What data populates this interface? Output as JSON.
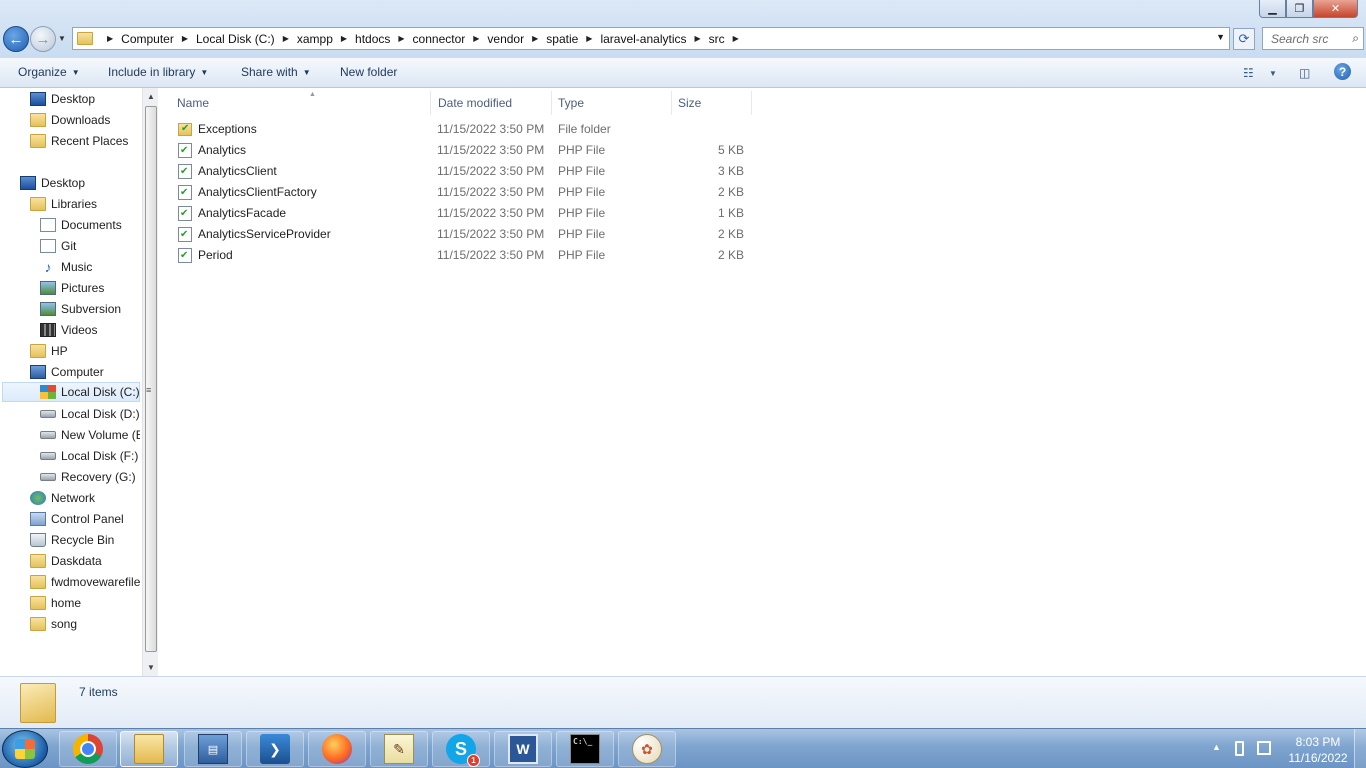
{
  "window": {
    "minimize": "▁",
    "maximize": "❐",
    "close": "✕"
  },
  "nav": {
    "back": "←",
    "forward": "→",
    "breadcrumbs": [
      "Computer",
      "Local Disk (C:)",
      "xampp",
      "htdocs",
      "connector",
      "vendor",
      "spatie",
      "laravel-analytics",
      "src"
    ],
    "search_placeholder": "Search src"
  },
  "toolbar": {
    "organize": "Organize",
    "include_in_library": "Include in library",
    "share_with": "Share with",
    "new_folder": "New folder",
    "help": "?"
  },
  "sidebar": {
    "items": [
      {
        "label": "Desktop",
        "icon": "desktop-icon"
      },
      {
        "label": "Downloads",
        "icon": "downloads-icon"
      },
      {
        "label": "Recent Places",
        "icon": "recent-places-icon"
      },
      {
        "label": "Desktop",
        "icon": "desktop-icon"
      },
      {
        "label": "Libraries",
        "icon": "libraries-icon"
      },
      {
        "label": "Documents",
        "icon": "documents-icon"
      },
      {
        "label": "Git",
        "icon": "git-icon"
      },
      {
        "label": "Music",
        "icon": "music-icon"
      },
      {
        "label": "Pictures",
        "icon": "pictures-icon"
      },
      {
        "label": "Subversion",
        "icon": "subversion-icon"
      },
      {
        "label": "Videos",
        "icon": "videos-icon"
      },
      {
        "label": "HP",
        "icon": "user-folder-icon"
      },
      {
        "label": "Computer",
        "icon": "computer-icon"
      },
      {
        "label": "Local Disk (C:)",
        "icon": "windows-drive-icon",
        "selected": true
      },
      {
        "label": "Local Disk (D:)",
        "icon": "drive-icon"
      },
      {
        "label": "New Volume (E",
        "icon": "drive-icon"
      },
      {
        "label": "Local Disk (F:)",
        "icon": "drive-icon"
      },
      {
        "label": "Recovery (G:)",
        "icon": "drive-icon"
      },
      {
        "label": "Network",
        "icon": "network-icon"
      },
      {
        "label": "Control Panel",
        "icon": "control-panel-icon"
      },
      {
        "label": "Recycle Bin",
        "icon": "recycle-bin-icon"
      },
      {
        "label": "Daskdata",
        "icon": "folder-icon"
      },
      {
        "label": "fwdmovewarefile",
        "icon": "folder-icon"
      },
      {
        "label": "home",
        "icon": "folder-icon"
      },
      {
        "label": "song",
        "icon": "folder-icon"
      }
    ]
  },
  "columns": {
    "name": "Name",
    "date": "Date modified",
    "type": "Type",
    "size": "Size"
  },
  "files": [
    {
      "name": "Exceptions",
      "date": "11/15/2022 3:50 PM",
      "type": "File folder",
      "size": ""
    },
    {
      "name": "Analytics",
      "date": "11/15/2022 3:50 PM",
      "type": "PHP File",
      "size": "5 KB"
    },
    {
      "name": "AnalyticsClient",
      "date": "11/15/2022 3:50 PM",
      "type": "PHP File",
      "size": "3 KB"
    },
    {
      "name": "AnalyticsClientFactory",
      "date": "11/15/2022 3:50 PM",
      "type": "PHP File",
      "size": "2 KB"
    },
    {
      "name": "AnalyticsFacade",
      "date": "11/15/2022 3:50 PM",
      "type": "PHP File",
      "size": "1 KB"
    },
    {
      "name": "AnalyticsServiceProvider",
      "date": "11/15/2022 3:50 PM",
      "type": "PHP File",
      "size": "2 KB"
    },
    {
      "name": "Period",
      "date": "11/15/2022 3:50 PM",
      "type": "PHP File",
      "size": "2 KB"
    }
  ],
  "status": {
    "item_count": "7 items"
  },
  "taskbar": {
    "apps": [
      {
        "name": "chrome-icon"
      },
      {
        "name": "windows-explorer-icon",
        "active": true
      },
      {
        "name": "network-connection-icon"
      },
      {
        "name": "powershell-icon"
      },
      {
        "name": "firefox-icon"
      },
      {
        "name": "notepad-icon"
      },
      {
        "name": "skype-icon",
        "badge": "1"
      },
      {
        "name": "word-icon"
      },
      {
        "name": "cmd-icon"
      },
      {
        "name": "paint-icon"
      }
    ],
    "clock_time": "8:03 PM",
    "clock_date": "11/16/2022"
  }
}
